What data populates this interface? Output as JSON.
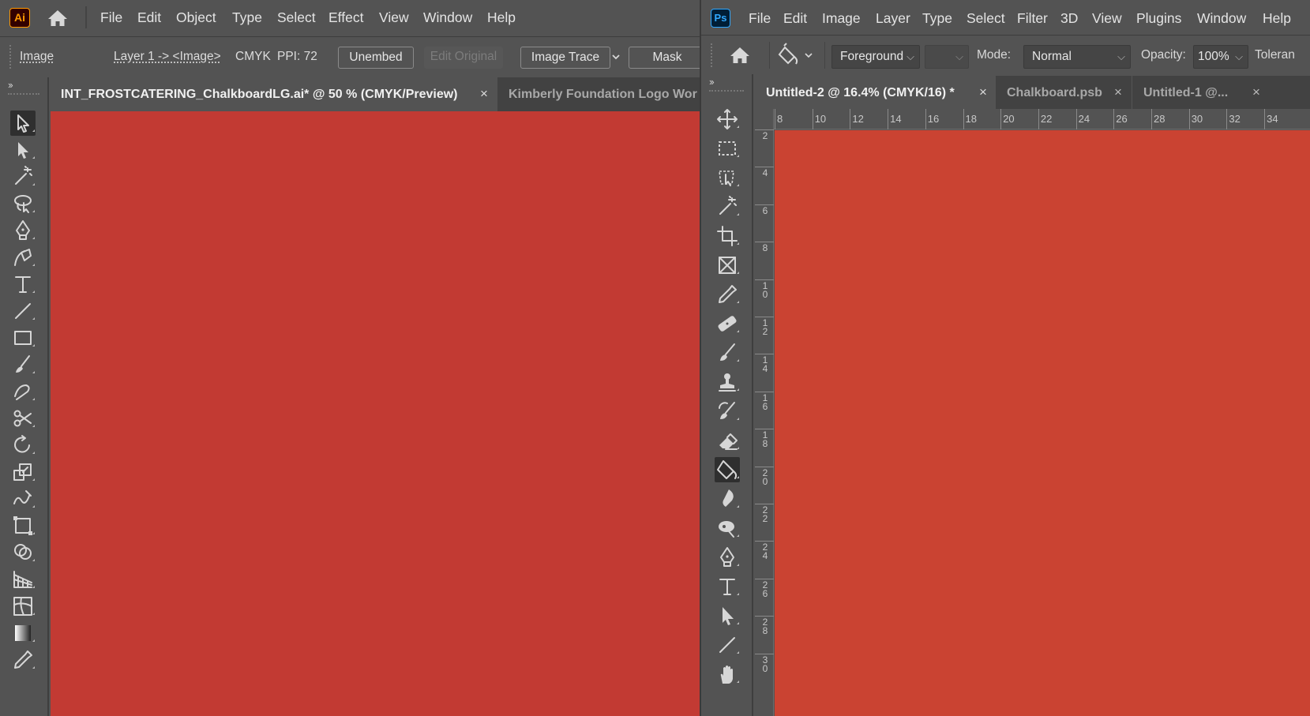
{
  "illustrator": {
    "logo": "Ai",
    "menu": [
      "File",
      "Edit",
      "Object",
      "Type",
      "Select",
      "Effect",
      "View",
      "Window",
      "Help"
    ],
    "control_bar": {
      "selection_label": "Image",
      "layer_path": "Layer 1 -> <Image>",
      "color_mode": "CMYK",
      "ppi": "PPI: 72",
      "unembed": "Unembed",
      "edit_original": "Edit Original",
      "image_trace": "Image Trace",
      "mask": "Mask"
    },
    "tabs": [
      {
        "label": "INT_FROSTCATERING_ChalkboardLG.ai* @ 50 % (CMYK/Preview)",
        "close": "×"
      },
      {
        "label": "Kimberly Foundation Logo Wor"
      }
    ],
    "canvas_color": "#c23a33",
    "tools": [
      "selection-icon",
      "direct-selection-icon",
      "magic-wand-icon",
      "lasso-icon",
      "pen-icon",
      "curvature-icon",
      "type-icon",
      "line-icon",
      "rectangle-icon",
      "paintbrush-icon",
      "shaper-icon",
      "scissors-icon",
      "rotate-icon",
      "scale-icon",
      "warp-icon",
      "free-transform-icon",
      "shape-builder-icon",
      "perspective-grid-icon",
      "mesh-icon",
      "gradient-icon",
      "eyedropper-icon"
    ]
  },
  "photoshop": {
    "logo": "Ps",
    "menu": [
      "File",
      "Edit",
      "Image",
      "Layer",
      "Type",
      "Select",
      "Filter",
      "3D",
      "View",
      "Plugins",
      "Window",
      "Help"
    ],
    "options_bar": {
      "fill_source": "Foreground",
      "mode_label": "Mode:",
      "mode_value": "Normal",
      "opacity_label": "Opacity:",
      "opacity_value": "100%",
      "tolerance_label": "Toleran"
    },
    "tabs": [
      {
        "label": "Untitled-2 @ 16.4% (CMYK/16) *",
        "close": "×"
      },
      {
        "label": "Chalkboard.psb",
        "close": "×"
      },
      {
        "label": "Untitled-1 @...",
        "close": "×"
      }
    ],
    "ruler_h": [
      "8",
      "10",
      "12",
      "14",
      "16",
      "18",
      "20",
      "22",
      "24",
      "26",
      "28",
      "30",
      "32",
      "34"
    ],
    "ruler_v": [
      "2",
      "4",
      "6",
      "8",
      "10",
      "12",
      "14",
      "16",
      "18",
      "20",
      "22",
      "24",
      "26",
      "28",
      "30"
    ],
    "canvas_color": "#ca4332",
    "tools": [
      "move-icon",
      "marquee-icon",
      "object-selection-icon",
      "magic-wand-icon",
      "crop-icon",
      "frame-icon",
      "eyedropper-icon",
      "healing-brush-icon",
      "brush-icon",
      "clone-stamp-icon",
      "history-brush-icon",
      "eraser-icon",
      "paint-bucket-icon",
      "blur-icon",
      "dodge-icon",
      "pen-icon",
      "type-icon",
      "path-selection-icon",
      "line-icon",
      "hand-icon"
    ]
  }
}
